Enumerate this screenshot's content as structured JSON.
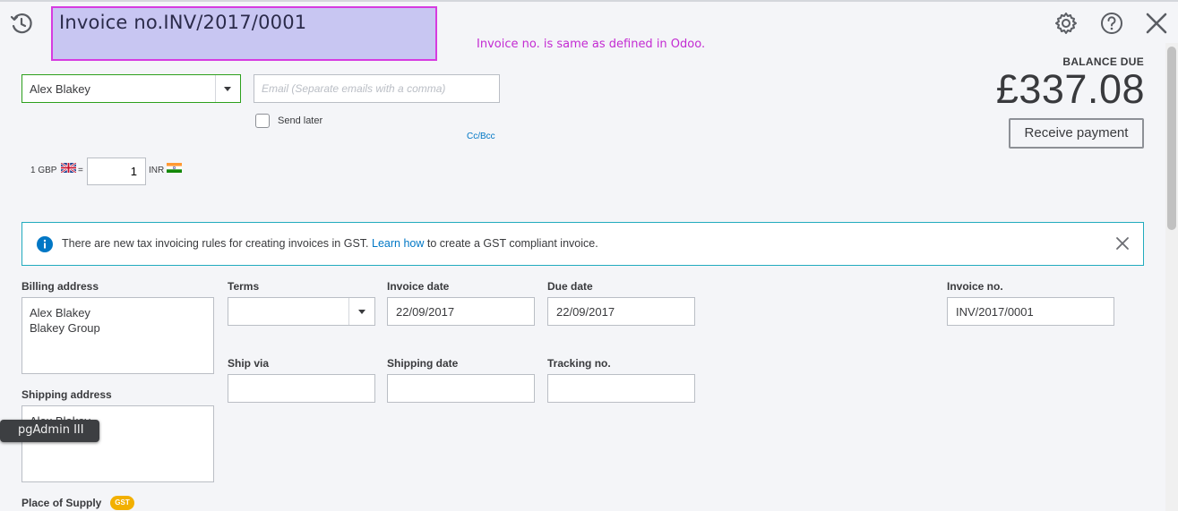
{
  "header": {
    "title": "Invoice no.INV/2017/0001",
    "annotation": "Invoice no. is same as defined in Odoo.",
    "icons": [
      "history-icon",
      "gear-icon",
      "help-icon",
      "close-icon"
    ]
  },
  "balance": {
    "label": "BALANCE DUE",
    "amount": "£337.08",
    "receive_payment_label": "Receive payment"
  },
  "customer": {
    "selected": "Alex Blakey",
    "email_placeholder": "Email (Separate emails with a comma)",
    "send_later_label": "Send later",
    "send_later_checked": false,
    "cc_bcc_label": "Cc/Bcc"
  },
  "exchange": {
    "left": "1 GBP",
    "equals": "=",
    "rate": "1",
    "right": "INR"
  },
  "gst_banner": {
    "text_before": "There are new tax invoicing rules for creating invoices in GST. ",
    "link": "Learn how",
    "text_after": " to create a GST compliant invoice."
  },
  "form": {
    "billing_address_label": "Billing address",
    "billing_address_line1": "Alex Blakey",
    "billing_address_line2": "Blakey Group",
    "shipping_address_label": "Shipping address",
    "shipping_address_line1": "Alex Blakey",
    "terms_label": "Terms",
    "terms_value": "",
    "invoice_date_label": "Invoice date",
    "invoice_date": "22/09/2017",
    "due_date_label": "Due date",
    "due_date": "22/09/2017",
    "invoice_no_label": "Invoice no.",
    "invoice_no": "INV/2017/0001",
    "ship_via_label": "Ship via",
    "ship_via": "",
    "shipping_date_label": "Shipping date",
    "shipping_date": "",
    "tracking_no_label": "Tracking no.",
    "tracking_no": "",
    "place_of_supply_label": "Place of Supply",
    "gst_badge": "GST"
  },
  "tooltip": {
    "text": "pgAdmin III"
  },
  "colors": {
    "accent_green": "#2ca01c",
    "link_blue": "#0077c5",
    "banner_border": "#21abbe",
    "annotation": "#c32bd2",
    "highlight_fill": "#c8c6f2",
    "highlight_border": "#d63be0",
    "gst_badge": "#f2b000"
  }
}
